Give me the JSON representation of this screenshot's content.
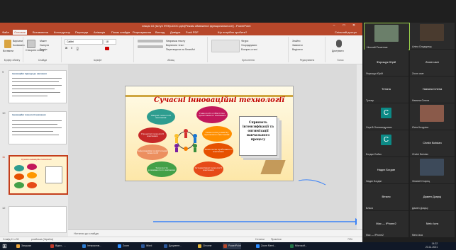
{
  "titlebar": {
    "title": "лекція 10 (вступ ФПК)LDOC.pptx[Режим обмеженої функціональності] - PowerPoint",
    "accent": "#b7472a"
  },
  "tabs": [
    "Файл",
    "Основне",
    "Вставлення",
    "Конструктор",
    "Переходи",
    "Анімація",
    "Показ слайдів",
    "Рецензування",
    "Вигляд",
    "Довідка",
    "Foxit PDF",
    "Що потрібно зробити?",
    "Спільний доступ"
  ],
  "ribbon": {
    "groups": [
      {
        "label": "Буфер обміну",
        "items": [
          "Вставити",
          "Вирізати",
          "Копіювати"
        ]
      },
      {
        "label": "Слайди",
        "items": [
          "Створити слайд",
          "Макет",
          "Скинути",
          "Розділ"
        ]
      },
      {
        "label": "Шрифт",
        "items": [
          "Calibri",
          "18",
          "Ж",
          "К",
          "П"
        ]
      },
      {
        "label": "Абзац",
        "items": [
          "Напрямок тексту",
          "Вирівняти текст",
          "Перетворити на SmartArt"
        ]
      },
      {
        "label": "Креслення",
        "items": [
          "Фігури",
          "Упорядкувати",
          "Експрес-стилі"
        ]
      },
      {
        "label": "Редагування",
        "items": [
          "Знайти",
          "Замінити",
          "Виділити"
        ]
      },
      {
        "label": "Голос",
        "items": [
          "Диктувати"
        ]
      }
    ]
  },
  "thumbs": [
    {
      "num": "9",
      "title": "Інноваційні підходи до навчання",
      "selected": false
    },
    {
      "num": "10",
      "title": "Інноваційні технології навчання",
      "selected": false
    },
    {
      "num": "11",
      "title": "Сучасні інноваційні технології",
      "selected": true
    },
    {
      "num": "12",
      "title": "",
      "selected": false
    }
  ],
  "slide": {
    "title": "Сучасні інноваційні технології",
    "bubbles": [
      "Хмарні технології навчання",
      "Технології особистісно орієнтованого навчання",
      "Проектні технології навчання",
      "Технологія розвитку критичного мислення",
      "Інформаційні комп'ютерні технології",
      "Технологія проблемного навчання",
      "Технологія розвиваючого навчання",
      "Інтерактивні технології навчання"
    ],
    "box_text": "Сприяють інтенсифікації та оптимізації навчального процесу"
  },
  "notes": {
    "placeholder": "Нотатки до слайда"
  },
  "status": {
    "slide": "Слайд 11 з 30",
    "lang": "російська (Україна)",
    "notes": "Нотатки",
    "comments": "Примітки",
    "zoom": "73%"
  },
  "participants": [
    {
      "label": "Ніколай Решетник",
      "name": "",
      "type": "photo",
      "color": "#6b7f6a"
    },
    {
      "label": "Аліна Сподарець",
      "name": "",
      "type": "photo",
      "color": "#4a3b2f"
    },
    {
      "label": "Форощук Юрій",
      "name": "Форощук Юрій",
      "type": "name"
    },
    {
      "label": "Zoom user",
      "name": "Zoom user",
      "type": "name"
    },
    {
      "label": "Тупчяр",
      "name": "Тетяна",
      "type": "name"
    },
    {
      "label": "Наємна Олена",
      "name": "Наємна Олена",
      "type": "name"
    },
    {
      "label": "Сергій Олександрович",
      "name": "",
      "type": "avatar",
      "letter": "C"
    },
    {
      "label": "Юлія Кочуріна",
      "name": "",
      "type": "photo",
      "color": "#8a5a4a"
    },
    {
      "label": "Богдан Бойко",
      "name": "",
      "type": "avatar",
      "letter": "C"
    },
    {
      "label": "Chekh Bohdan",
      "name": "Chekh Bohdan",
      "type": "name"
    },
    {
      "label": "Надєє Богдан",
      "name": "Надєє Богдан",
      "type": "name"
    },
    {
      "label": "Зінатий Старец",
      "name": "",
      "type": "photo",
      "color": "#3d4a5a"
    },
    {
      "label": "Влася",
      "name": "Віталя",
      "type": "name"
    },
    {
      "label": "Дамен Дзарці",
      "name": "Дамен Дзарці",
      "type": "name"
    },
    {
      "label": "Mac — iPhone2",
      "name": "Mac — iPhone2",
      "type": "name"
    },
    {
      "label": "Melo Izza",
      "name": "Melo Izza",
      "type": "name"
    }
  ],
  "taskbar": [
    {
      "label": "Загрузки",
      "color": "#e8a33d"
    },
    {
      "label": "Відео - ...",
      "color": "#c0392b"
    },
    {
      "label": "Інтерактив...",
      "color": "#2d7dd2"
    },
    {
      "label": "Zoom",
      "color": "#2d8cff"
    },
    {
      "label": "Word",
      "color": "#2b579a"
    },
    {
      "label": "Документ...",
      "color": "#2b579a"
    },
    {
      "label": "Chrome",
      "color": "#e0b33a"
    },
    {
      "label": "PowerPoint",
      "color": "#b7472a"
    },
    {
      "label": "Zoom Meet...",
      "color": "#2d8cff"
    },
    {
      "label": "Microsoft...",
      "color": "#217346"
    }
  ],
  "clock": {
    "time": "14:22",
    "date": "23.11.2021"
  }
}
